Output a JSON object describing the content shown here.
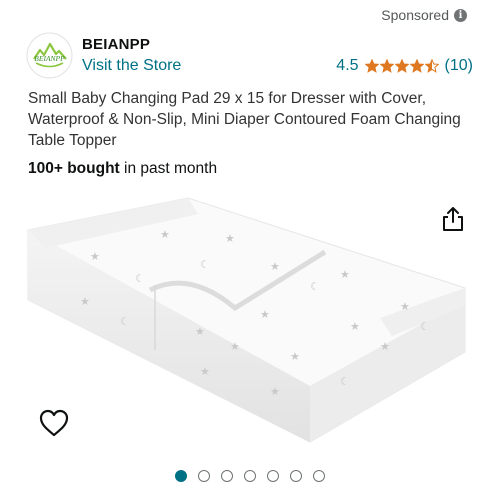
{
  "ad": {
    "sponsored_label": "Sponsored",
    "info_icon": "i"
  },
  "brand": {
    "logo_text": "BEIANPP",
    "name": "BEIANPP",
    "visit_store": "Visit the Store"
  },
  "rating": {
    "value": "4.5",
    "stars": 4.5,
    "count": "(10)",
    "star_color": "#de7921"
  },
  "product": {
    "title": "Small Baby Changing Pad 29 x 15 for Dresser with Cover, Waterproof & Non-Slip, Mini Diaper Contoured Foam Changing Table Topper",
    "bought_strong": "100+ bought",
    "bought_rest": " in past month"
  },
  "actions": {
    "share_icon": "share-icon",
    "wishlist_icon": "heart-icon"
  },
  "carousel": {
    "count": 7,
    "active_index": 0
  },
  "colors": {
    "link": "#007185",
    "text": "#0f1111",
    "muted": "#565959"
  }
}
